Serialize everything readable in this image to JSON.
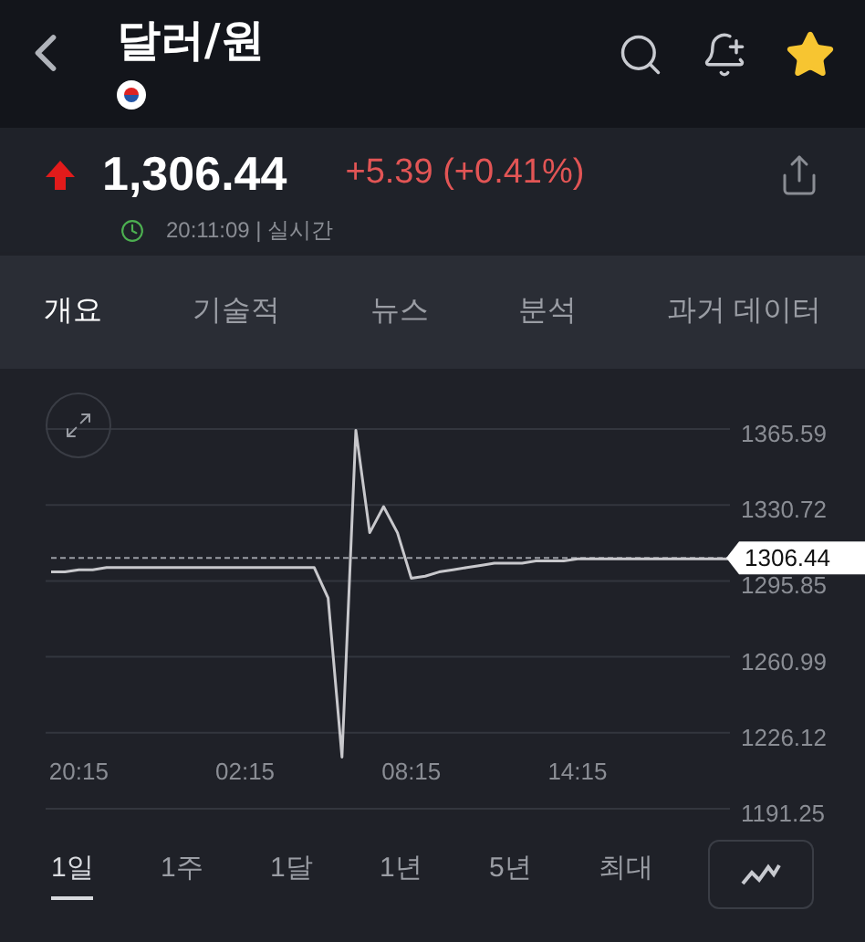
{
  "header": {
    "title": "달러/원",
    "favorite": true
  },
  "quote": {
    "price": "1,306.44",
    "rising": true,
    "change": "+5.39 (+0.41%)",
    "time": "20:11:09 | 실시간"
  },
  "tabs": [
    {
      "label": "개요",
      "selected": true
    },
    {
      "label": "기술적",
      "selected": false
    },
    {
      "label": "뉴스",
      "selected": false
    },
    {
      "label": "분석",
      "selected": false
    },
    {
      "label": "과거 데이터",
      "selected": false
    }
  ],
  "chart": {
    "chart_data": {
      "type": "line",
      "grid": true,
      "categories": [
        null,
        null,
        "20:15",
        null,
        null,
        null,
        null,
        null,
        null,
        null,
        null,
        null,
        null,
        null,
        "02:15",
        null,
        null,
        null,
        null,
        null,
        null,
        null,
        null,
        null,
        null,
        null,
        "08:15",
        null,
        null,
        null,
        null,
        null,
        null,
        null,
        null,
        null,
        null,
        null,
        "14:15",
        null,
        null,
        null,
        null,
        null,
        null,
        null,
        null,
        null,
        null,
        null
      ],
      "series": [
        {
          "color": "#c8c8cc",
          "values": [
            1300,
            1300,
            1301,
            1301,
            1302,
            1302,
            1302,
            1302,
            1302,
            1302,
            1302,
            1302,
            1302,
            1302,
            1302,
            1302,
            1302,
            1302,
            1302,
            1302,
            1288,
            1215,
            1365,
            1318,
            1330,
            1318,
            1297,
            1298,
            1300,
            1301,
            1302,
            1303,
            1304,
            1304,
            1304,
            1305,
            1305,
            1305,
            1306,
            1306,
            1306,
            1306,
            1306,
            1306,
            1306,
            1306,
            1306,
            1306,
            1306,
            1306
          ]
        },
        {
          "name": "1306.44",
          "color": "#9a9da4",
          "line_style": "dashed",
          "values": [
            1306.44,
            1306.44,
            1306.44,
            1306.44,
            1306.44,
            1306.44,
            1306.44,
            1306.44,
            1306.44,
            1306.44,
            1306.44,
            1306.44,
            1306.44,
            1306.44,
            1306.44,
            1306.44,
            1306.44,
            1306.44,
            1306.44,
            1306.44,
            1306.44,
            1306.44,
            1306.44,
            1306.44,
            1306.44,
            1306.44,
            1306.44,
            1306.44,
            1306.44,
            1306.44,
            1306.44,
            1306.44,
            1306.44,
            1306.44,
            1306.44,
            1306.44,
            1306.44,
            1306.44,
            1306.44,
            1306.44,
            1306.44,
            1306.44,
            1306.44,
            1306.44,
            1306.44,
            1306.44,
            1306.44,
            1306.44,
            1306.44,
            1306.44
          ]
        }
      ],
      "ylim": [
        1191.25,
        1365.59
      ],
      "yticks": [
        1365.59,
        1330.72,
        1295.85,
        1260.99,
        1226.12,
        1191.25
      ]
    }
  },
  "periods": [
    {
      "label": "1일",
      "selected": true
    },
    {
      "label": "1주",
      "selected": false
    },
    {
      "label": "1달",
      "selected": false
    },
    {
      "label": "1년",
      "selected": false
    },
    {
      "label": "5년",
      "selected": false
    },
    {
      "label": "최대",
      "selected": false
    }
  ]
}
